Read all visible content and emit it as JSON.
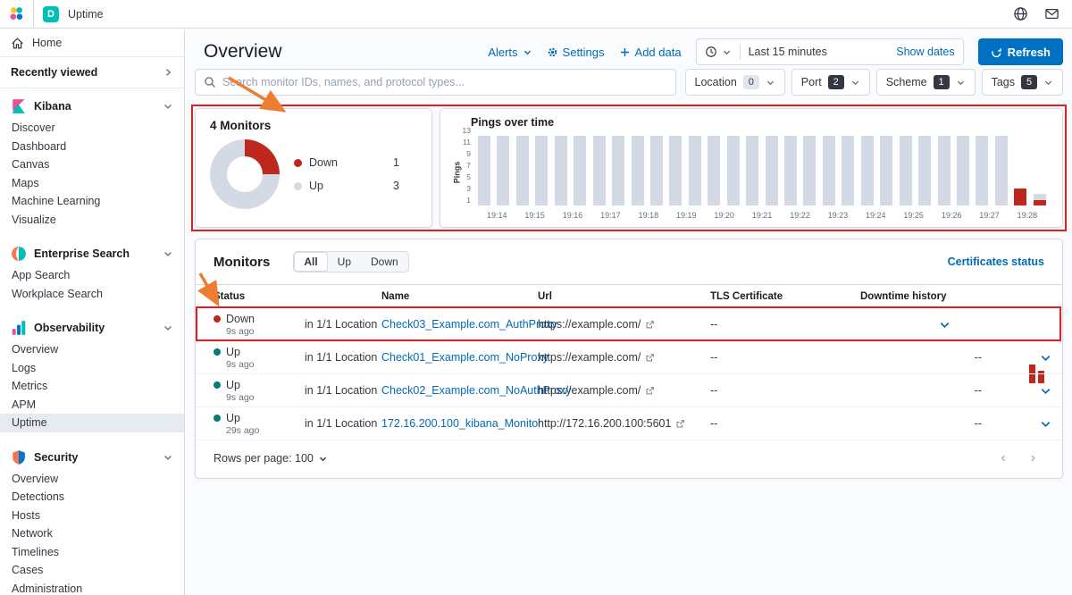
{
  "theme": {
    "accent": "#006BB4",
    "refresh_blue": "#0071C2",
    "danger": "#BD271E",
    "success": "#017D73",
    "bar_gray": "#D3DAE6",
    "annotation_red": "#E02020",
    "annotation_orange": "#ED7D31"
  },
  "header": {
    "space_badge": "D",
    "breadcrumb": "Uptime",
    "right_icons": [
      "globe-icon",
      "mail-icon"
    ]
  },
  "sidebar": {
    "home_label": "Home",
    "recently_viewed_label": "Recently viewed",
    "sections": [
      {
        "id": "kibana",
        "label": "Kibana",
        "icon": "kibana-icon",
        "items": [
          "Discover",
          "Dashboard",
          "Canvas",
          "Maps",
          "Machine Learning",
          "Visualize"
        ]
      },
      {
        "id": "enterprise-search",
        "label": "Enterprise Search",
        "icon": "enterprise-search-icon",
        "items": [
          "App Search",
          "Workplace Search"
        ]
      },
      {
        "id": "observability",
        "label": "Observability",
        "icon": "observability-icon",
        "items": [
          "Overview",
          "Logs",
          "Metrics",
          "APM",
          "Uptime"
        ],
        "selected_item": "Uptime"
      },
      {
        "id": "security",
        "label": "Security",
        "icon": "security-icon",
        "items": [
          "Overview",
          "Detections",
          "Hosts",
          "Network",
          "Timelines",
          "Cases",
          "Administration"
        ]
      }
    ]
  },
  "page": {
    "title": "Overview",
    "actions": {
      "alerts": "Alerts",
      "settings": "Settings",
      "add_data": "Add data",
      "time_range": "Last 15 minutes",
      "show_dates": "Show dates",
      "refresh": "Refresh"
    },
    "search_placeholder": "Search monitor IDs, names, and protocol types...",
    "filters": [
      {
        "label": "Location",
        "count": "0",
        "dark_badge": false
      },
      {
        "label": "Port",
        "count": "2",
        "dark_badge": true
      },
      {
        "label": "Scheme",
        "count": "1",
        "dark_badge": true
      },
      {
        "label": "Tags",
        "count": "5",
        "dark_badge": true
      }
    ]
  },
  "chart_data": [
    {
      "type": "pie",
      "title": "4 Monitors",
      "labels": [
        "Down",
        "Up"
      ],
      "values": [
        1,
        3
      ],
      "colors": [
        "#BD271E",
        "#D3DAE6"
      ],
      "legend_position": "right"
    },
    {
      "type": "bar",
      "title": "Pings over time",
      "xlabel": "",
      "ylabel": "Pings",
      "yticks": [
        1,
        3,
        5,
        7,
        9,
        11,
        13
      ],
      "ylim": [
        0,
        13
      ],
      "x_labels": [
        "19:14",
        "19:15",
        "19:16",
        "19:17",
        "19:18",
        "19:19",
        "19:20",
        "19:21",
        "19:22",
        "19:23",
        "19:24",
        "19:25",
        "19:26",
        "19:27",
        "19:28"
      ],
      "bars_per_label": 2,
      "series": [
        {
          "name": "Up",
          "color": "#D3DAE6",
          "values": [
            12,
            12,
            12,
            12,
            12,
            12,
            12,
            12,
            12,
            12,
            12,
            12,
            12,
            12,
            12,
            12,
            12,
            12,
            12,
            12,
            12,
            12,
            12,
            12,
            12,
            12,
            12,
            12,
            0,
            1
          ]
        },
        {
          "name": "Down",
          "color": "#BD271E",
          "values": [
            0,
            0,
            0,
            0,
            0,
            0,
            0,
            0,
            0,
            0,
            0,
            0,
            0,
            0,
            0,
            0,
            0,
            0,
            0,
            0,
            0,
            0,
            0,
            0,
            0,
            0,
            0,
            0,
            3,
            1
          ]
        }
      ]
    }
  ],
  "monitors": {
    "title": "Monitors",
    "tabs": [
      "All",
      "Up",
      "Down"
    ],
    "selected_tab": "All",
    "certificates_link": "Certificates status",
    "columns": [
      "Status",
      "Name",
      "Url",
      "TLS Certificate",
      "Downtime history"
    ],
    "rows": [
      {
        "status": "Down",
        "ago": "9s ago",
        "location": "in 1/1 Location",
        "name": "Check03_Example.com_AuthProxy",
        "url": "https://example.com/",
        "tls": "--",
        "downtime_history": [
          3,
          2
        ],
        "annotated": true
      },
      {
        "status": "Up",
        "ago": "9s ago",
        "location": "in 1/1 Location",
        "name": "Check01_Example.com_NoProxy",
        "url": "https://example.com/",
        "tls": "--",
        "downtime_history": null,
        "annotated": false
      },
      {
        "status": "Up",
        "ago": "9s ago",
        "location": "in 1/1 Location",
        "name": "Check02_Example.com_NoAuthProxy",
        "url": "https://example.com/",
        "tls": "--",
        "downtime_history": null,
        "annotated": false
      },
      {
        "status": "Up",
        "ago": "29s ago",
        "location": "in 1/1 Location",
        "name": "172.16.200.100_kibana_Monitor",
        "url": "http://172.16.200.100:5601",
        "tls": "--",
        "downtime_history": null,
        "annotated": false
      }
    ],
    "rows_per_page": "Rows per page: 100",
    "pager": {
      "prev": "‹",
      "next": "›"
    }
  }
}
